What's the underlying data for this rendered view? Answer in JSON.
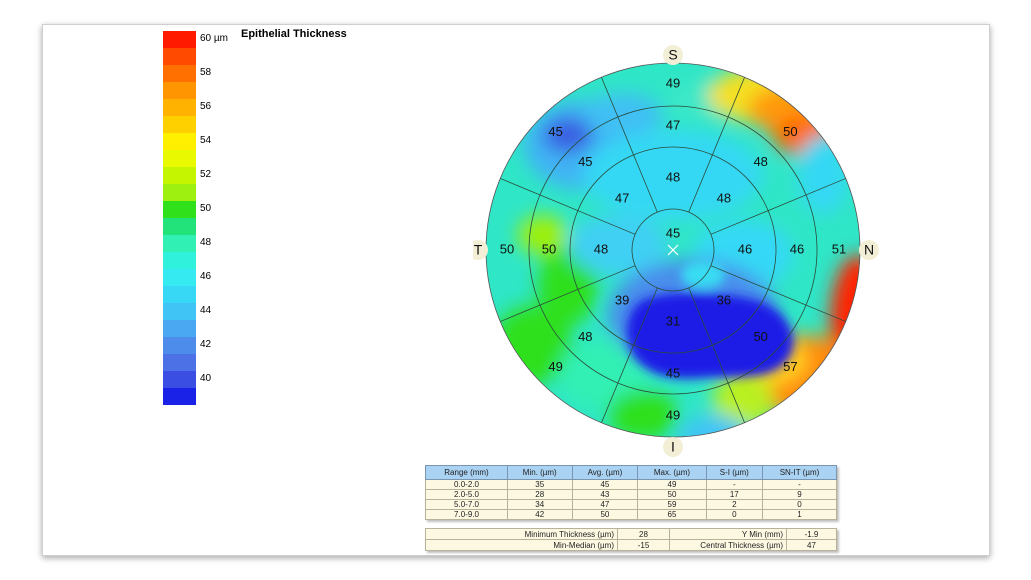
{
  "title": "Epithelial Thickness",
  "legend": {
    "colors": [
      "#ff1a00",
      "#ff4a00",
      "#ff7000",
      "#ff9500",
      "#ffb300",
      "#ffd000",
      "#fff000",
      "#e8f900",
      "#c6f500",
      "#9ef010",
      "#2fe01a",
      "#22e27a",
      "#30f0b4",
      "#30f2dc",
      "#36eaf2",
      "#36d8f6",
      "#40c4f6",
      "#4aa8f2",
      "#4e8cec",
      "#4c70e6",
      "#3a4ee4",
      "#1a22e8"
    ],
    "labels": [
      {
        "text": "60 µm",
        "value": 60
      },
      {
        "text": "58",
        "value": 58
      },
      {
        "text": "56",
        "value": 56
      },
      {
        "text": "54",
        "value": 54
      },
      {
        "text": "52",
        "value": 52
      },
      {
        "text": "50",
        "value": 50
      },
      {
        "text": "48",
        "value": 48
      },
      {
        "text": "46",
        "value": 46
      },
      {
        "text": "44",
        "value": 44
      },
      {
        "text": "42",
        "value": 42
      },
      {
        "text": "40",
        "value": 40
      }
    ]
  },
  "directions": {
    "superior": "S",
    "inferior": "I",
    "temporal": "T",
    "nasal": "N"
  },
  "zones": {
    "center": "45",
    "ring2": [
      "48",
      "48",
      "46",
      "36",
      "31",
      "39",
      "48",
      "47"
    ],
    "ring3": [
      "47",
      "48",
      "46",
      "50",
      "45",
      "48",
      "50",
      "45"
    ],
    "ring4": [
      "49",
      "50",
      "51",
      "57",
      "49",
      "49",
      "50",
      "45"
    ]
  },
  "range_table": {
    "headers": [
      "Range (mm)",
      "Min. (µm)",
      "Avg. (µm)",
      "Max. (µm)",
      "S-I (µm)",
      "SN-IT (µm)"
    ],
    "rows": [
      [
        "0.0-2.0",
        "35",
        "45",
        "49",
        "-",
        "-"
      ],
      [
        "2.0-5.0",
        "28",
        "43",
        "50",
        "17",
        "9"
      ],
      [
        "5.0-7.0",
        "34",
        "47",
        "59",
        "2",
        "0"
      ],
      [
        "7.0-9.0",
        "42",
        "50",
        "65",
        "0",
        "1"
      ]
    ]
  },
  "stats": {
    "min_thickness_label": "Minimum Thickness (µm)",
    "min_thickness": "28",
    "ymin_label": "Y Min (mm)",
    "ymin": "-1.9",
    "min_median_label": "Min-Median (µm)",
    "min_median": "-15",
    "central_label": "Central Thickness (µm)",
    "central": "47"
  }
}
